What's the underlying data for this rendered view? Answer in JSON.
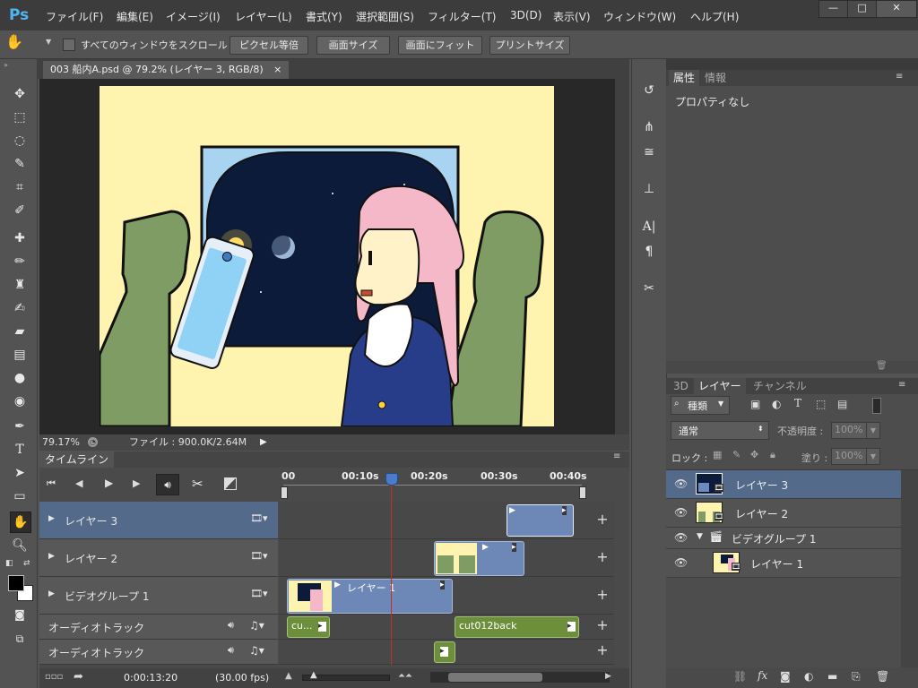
{
  "app": {
    "logo": "Ps"
  },
  "menu": [
    "ファイル(F)",
    "編集(E)",
    "イメージ(I)",
    "レイヤー(L)",
    "書式(Y)",
    "選択範囲(S)",
    "フィルター(T)",
    "3D(D)",
    "表示(V)",
    "ウィンドウ(W)",
    "ヘルプ(H)"
  ],
  "window_controls": {
    "minimize": "—",
    "maximize": "□",
    "close": "✕"
  },
  "options_bar": {
    "scroll_all_label": "すべてのウィンドウをスクロール",
    "buttons": [
      "ピクセル等倍",
      "画面サイズ",
      "画面にフィット",
      "プリントサイズ"
    ]
  },
  "document": {
    "tab_title": "003 船内A.psd @ 79.2% (レイヤー 3, RGB/8)",
    "tab_close": "×",
    "zoom": "79.17%",
    "file_info": "ファイル : 900.0K/2.64M"
  },
  "timeline": {
    "title": "タイムライン",
    "ruler": [
      "00",
      "00:10s",
      "00:20s",
      "00:30s",
      "00:40s"
    ],
    "playhead_progress": 0.36,
    "tracks": [
      {
        "name": "レイヤー 3",
        "selected": true
      },
      {
        "name": "レイヤー 2",
        "selected": false
      },
      {
        "name": "ビデオグループ 1",
        "selected": false
      },
      {
        "name": "オーディオトラック",
        "selected": false
      },
      {
        "name": "オーディオトラック",
        "selected": false
      }
    ],
    "clips": {
      "group_clip_label": "レイヤー 1",
      "audio1_clip_a": "cu...",
      "audio1_clip_b": "cut012back"
    },
    "timecode": "0:00:13:20",
    "fps": "(30.00 fps)"
  },
  "properties_panel": {
    "tabs": [
      "属性",
      "情報"
    ],
    "content": "プロパティなし"
  },
  "layers_panel": {
    "tabs": [
      "3D",
      "レイヤー",
      "チャンネル"
    ],
    "filter_kind": "種類",
    "blend_mode": "通常",
    "opacity_label": "不透明度 :",
    "opacity_value": "100%",
    "lock_label": "ロック :",
    "fill_label": "塗り :",
    "fill_value": "100%",
    "layers": [
      {
        "name": "レイヤー 3",
        "selected": true
      },
      {
        "name": "レイヤー 2",
        "selected": false
      },
      {
        "name": "ビデオグループ 1",
        "selected": false
      },
      {
        "name": "レイヤー 1",
        "selected": false
      }
    ]
  },
  "colors": {
    "accent_selected": "#536a8a",
    "clip_blue": "#6d87b6",
    "clip_green": "#6d8f3c",
    "playhead": "#c0302a"
  }
}
